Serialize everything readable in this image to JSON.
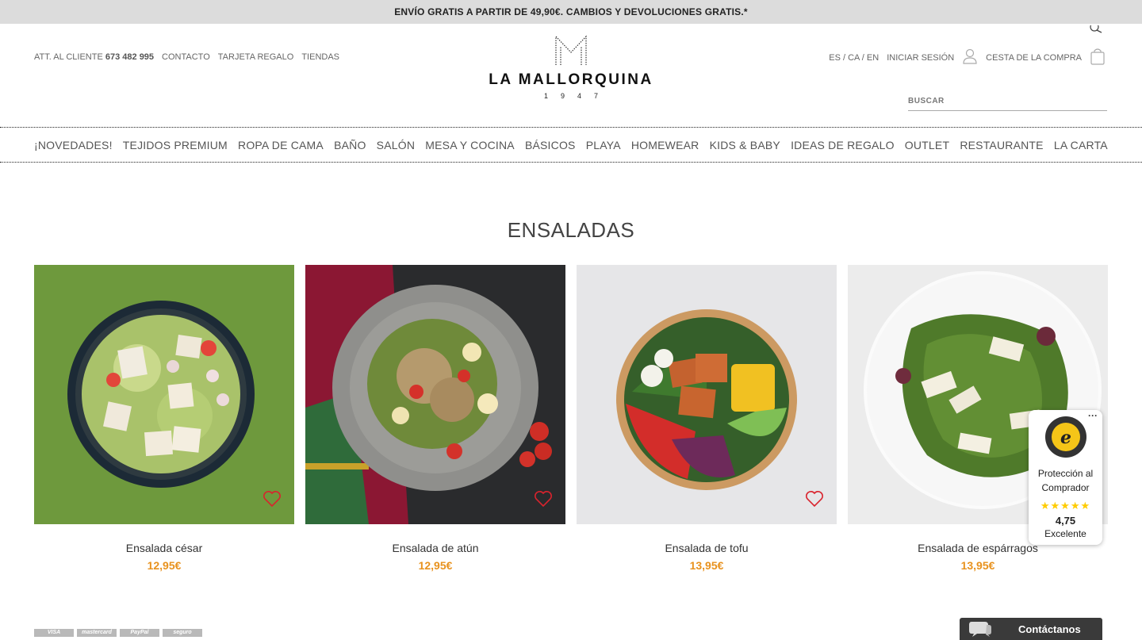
{
  "promo": {
    "text": "ENVÍO GRATIS A PARTIR DE 49,90€. CAMBIOS Y DEVOLUCIONES GRATIS.*"
  },
  "utility_left": {
    "att_label": "ATT. AL CLIENTE",
    "phone": "673 482 995",
    "contacto": "CONTACTO",
    "tarjeta": "TARJETA REGALO",
    "tiendas": "TIENDAS"
  },
  "logo": {
    "name": "LA MALLORQUINA",
    "year": "1947"
  },
  "utility_right": {
    "languages": "ES / CA / EN",
    "login": "INICIAR SESIÓN",
    "cart": "CESTA DE LA COMPRA"
  },
  "search": {
    "placeholder": "BUSCAR"
  },
  "nav": [
    "¡NOVEDADES!",
    "TEJIDOS PREMIUM",
    "ROPA DE CAMA",
    "BAÑO",
    "SALÓN",
    "MESA Y COCINA",
    "BÁSICOS",
    "PLAYA",
    "HOMEWEAR",
    "KIDS & BABY",
    "IDEAS DE REGALO",
    "OUTLET",
    "RESTAURANTE",
    "LA CARTA"
  ],
  "section_title": "ENSALADAS",
  "products": [
    {
      "name": "Ensalada césar",
      "price": "12,95€"
    },
    {
      "name": "Ensalada de atún",
      "price": "12,95€"
    },
    {
      "name": "Ensalada de tofu",
      "price": "13,95€"
    },
    {
      "name": "Ensalada de espárragos",
      "price": "13,95€"
    }
  ],
  "trust": {
    "more": "···",
    "label": "Protección al Comprador",
    "score": "4,75",
    "rating": "Excelente",
    "stars": "★★★★★"
  },
  "footer": {
    "payments": [
      "VISA",
      "mastercard",
      "PayPal",
      "seguro"
    ],
    "contact": "Contáctanos"
  },
  "colors": {
    "accent": "#e8921e",
    "promo_bg": "#dcdcdc",
    "heart": "#d9232d",
    "contact_bg": "#3a3a3a"
  }
}
